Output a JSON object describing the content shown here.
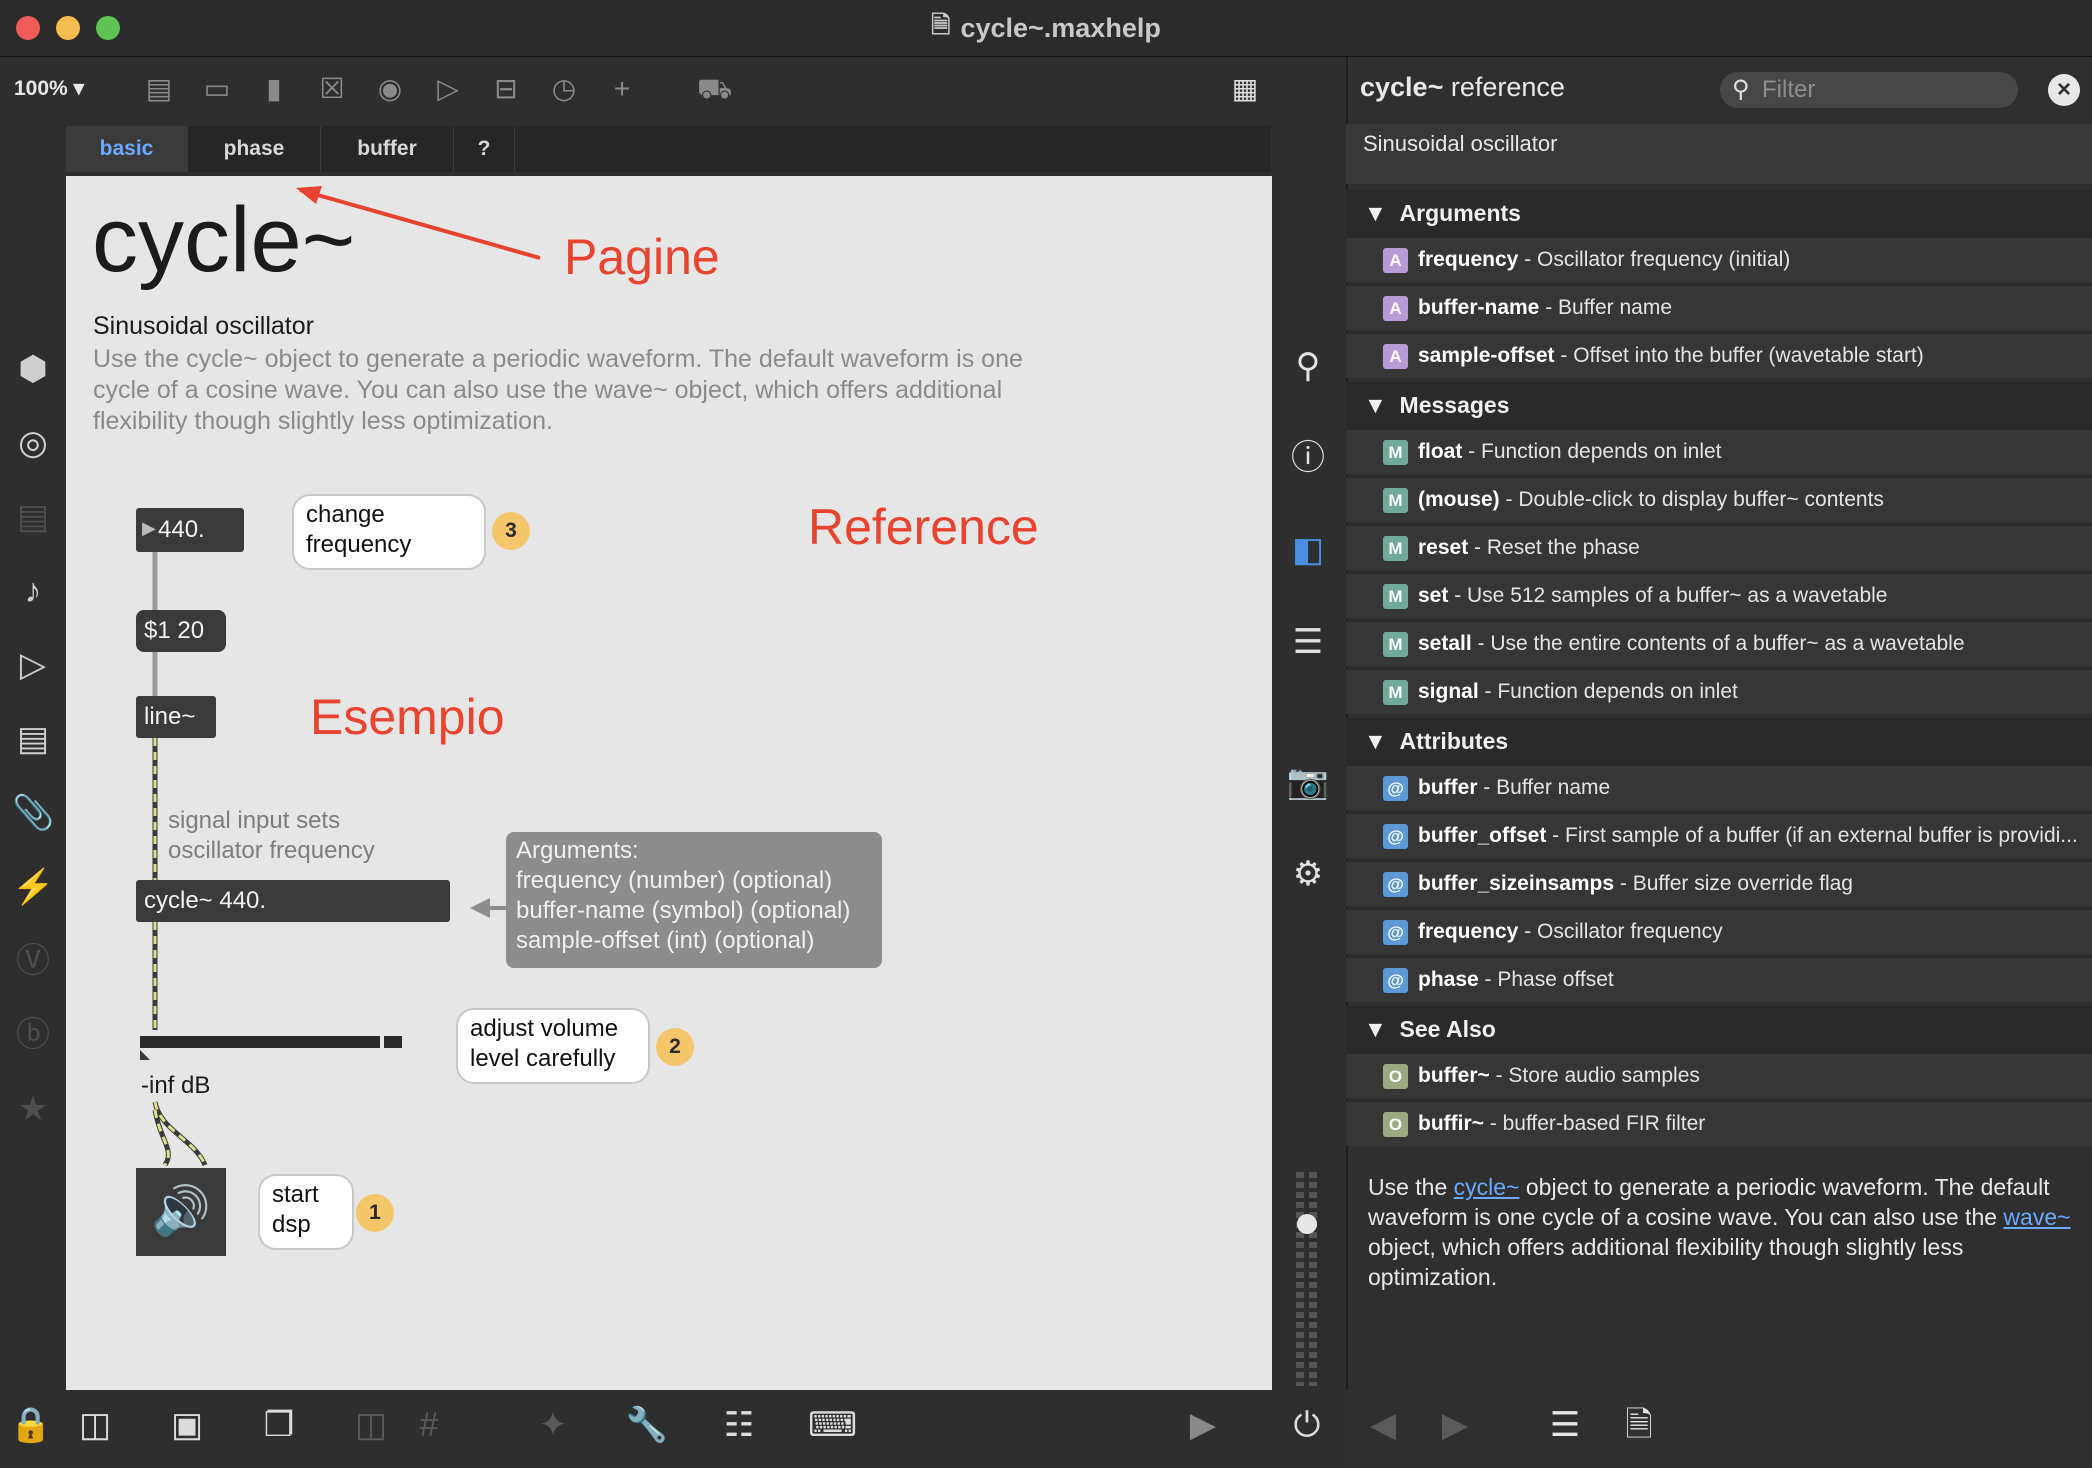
{
  "window": {
    "title": "cycle~.maxhelp"
  },
  "toolbar": {
    "zoom": "100%"
  },
  "tabs": [
    {
      "label": "basic"
    },
    {
      "label": "phase"
    },
    {
      "label": "buffer"
    },
    {
      "label": "?"
    }
  ],
  "patcher": {
    "title": "cycle~",
    "subtitle": "Sinusoidal oscillator",
    "description": "Use the cycle~ object to generate a periodic waveform. The default waveform is one cycle of a cosine wave. You can also use the wave~ object, which offers additional flexibility though slightly less optimization.",
    "number_box": "440.",
    "message_box": "$1 20",
    "line_obj": "line~",
    "cycle_obj": "cycle~ 440.",
    "signal_comment_1": "signal input sets",
    "signal_comment_2": "oscillator frequency",
    "gain_readout": "-inf dB",
    "bubbles": {
      "change_freq_1": "change",
      "change_freq_2": "frequency",
      "adjust_vol_1": "adjust volume",
      "adjust_vol_2": "level carefully",
      "start_dsp_1": "start",
      "start_dsp_2": "dsp"
    },
    "badges": {
      "b1": "1",
      "b2": "2",
      "b3": "3"
    },
    "arguments_box": {
      "heading": "Arguments:",
      "line1": "frequency (number) (optional)",
      "line2": "buffer-name (symbol) (optional)",
      "line3": "sample-offset (int) (optional)"
    },
    "annotations": {
      "pagine": "Pagine",
      "reference": "Reference",
      "esempio": "Esempio"
    }
  },
  "reference": {
    "object_name": "cycle~",
    "heading_suffix": "reference",
    "filter_placeholder": "Filter",
    "subtitle": "Sinusoidal oscillator",
    "sections": {
      "arguments": "Arguments",
      "messages": "Messages",
      "attributes": "Attributes",
      "see_also": "See Also"
    },
    "arguments": [
      {
        "tag": "A",
        "name": "frequency",
        "desc": " - Oscillator frequency (initial)"
      },
      {
        "tag": "A",
        "name": "buffer-name",
        "desc": " - Buffer name"
      },
      {
        "tag": "A",
        "name": "sample-offset",
        "desc": " - Offset into the buffer (wavetable start)"
      }
    ],
    "messages": [
      {
        "tag": "M",
        "name": "float",
        "desc": " - Function depends on inlet"
      },
      {
        "tag": "M",
        "name": "(mouse)",
        "desc": " - Double-click to display buffer~ contents"
      },
      {
        "tag": "M",
        "name": "reset",
        "desc": " - Reset the phase"
      },
      {
        "tag": "M",
        "name": "set",
        "desc": " - Use 512 samples of a buffer~ as a wavetable"
      },
      {
        "tag": "M",
        "name": "setall",
        "desc": " - Use the entire contents of a buffer~ as a wavetable"
      },
      {
        "tag": "M",
        "name": "signal",
        "desc": " - Function depends on inlet"
      }
    ],
    "attributes": [
      {
        "tag": "@",
        "name": "buffer",
        "desc": " - Buffer name"
      },
      {
        "tag": "@",
        "name": "buffer_offset",
        "desc": " - First sample of a buffer (if an external buffer is providi..."
      },
      {
        "tag": "@",
        "name": "buffer_sizeinsamps",
        "desc": " - Buffer size override flag"
      },
      {
        "tag": "@",
        "name": "frequency",
        "desc": " - Oscillator frequency"
      },
      {
        "tag": "@",
        "name": "phase",
        "desc": " - Phase offset"
      }
    ],
    "see_also": [
      {
        "tag": "O",
        "name": "buffer~",
        "desc": " - Store audio samples"
      },
      {
        "tag": "O",
        "name": "buffir~",
        "desc": " - buffer-based FIR filter"
      }
    ],
    "desc_p1": "Use the ",
    "desc_link1": "cycle~",
    "desc_p2": " object to generate a periodic waveform. The default waveform is one cycle of a cosine wave. You can also use the ",
    "desc_link2": "wave~",
    "desc_p3": " object, which offers additional flexibility though slightly less optimization."
  },
  "colors": {
    "accent": "#6aa9ff",
    "annotation": "#e8432e",
    "arg_tag": "#b89ad8",
    "msg_tag": "#6fa99a",
    "attr_tag": "#5b9ad6",
    "seealso_tag": "#9aa982",
    "badge": "#f6c66b"
  }
}
